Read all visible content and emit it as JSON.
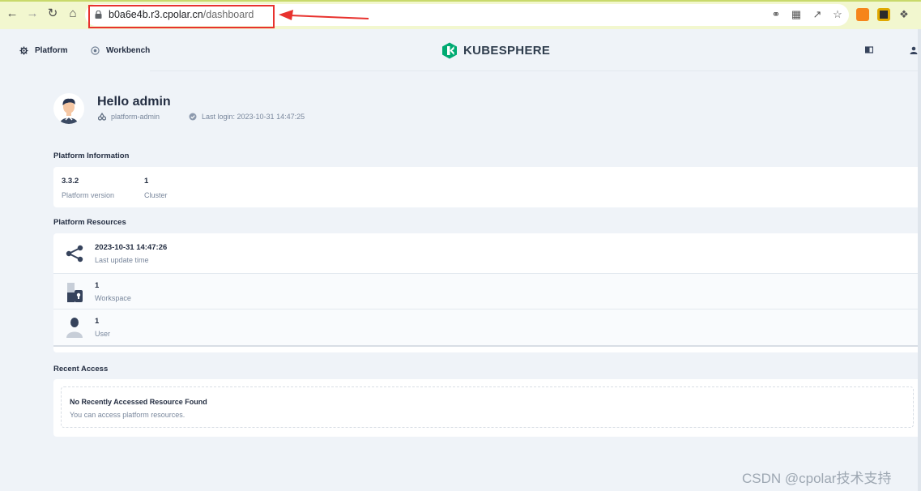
{
  "browser": {
    "url_host": "b0a6e4b.r3.cpolar.cn",
    "url_path": "/dashboard",
    "icons": [
      "back-icon",
      "forward-icon",
      "reload-icon",
      "home-icon",
      "lock-icon",
      "key-icon",
      "translate-icon",
      "share-icon",
      "star-icon",
      "metamask-icon",
      "extension-icon",
      "puzzle-icon"
    ]
  },
  "header": {
    "platform_label": "Platform",
    "workbench_label": "Workbench",
    "logo_text": "KUBESPHERE"
  },
  "profile": {
    "greeting": "Hello admin",
    "role": "platform-admin",
    "last_login": "Last login: 2023-10-31 14:47:25"
  },
  "platform_info": {
    "title": "Platform Information",
    "items": [
      {
        "value": "3.3.2",
        "label": "Platform version"
      },
      {
        "value": "1",
        "label": "Cluster"
      }
    ]
  },
  "platform_resources": {
    "title": "Platform Resources",
    "items": [
      {
        "value": "2023-10-31 14:47:26",
        "label": "Last update time",
        "icon": "share-nodes-icon"
      },
      {
        "value": "1",
        "label": "Workspace",
        "icon": "workspace-icon"
      },
      {
        "value": "1",
        "label": "User",
        "icon": "user-icon"
      }
    ]
  },
  "recent_access": {
    "title": "Recent Access",
    "empty_title": "No Recently Accessed Resource Found",
    "empty_desc": "You can access platform resources."
  },
  "watermark": "CSDN @cpolar技术支持",
  "colors": {
    "accent_green": "#00aa72",
    "highlight_red": "#e8322e",
    "text_dark": "#242e42",
    "text_muted": "#79879c"
  }
}
